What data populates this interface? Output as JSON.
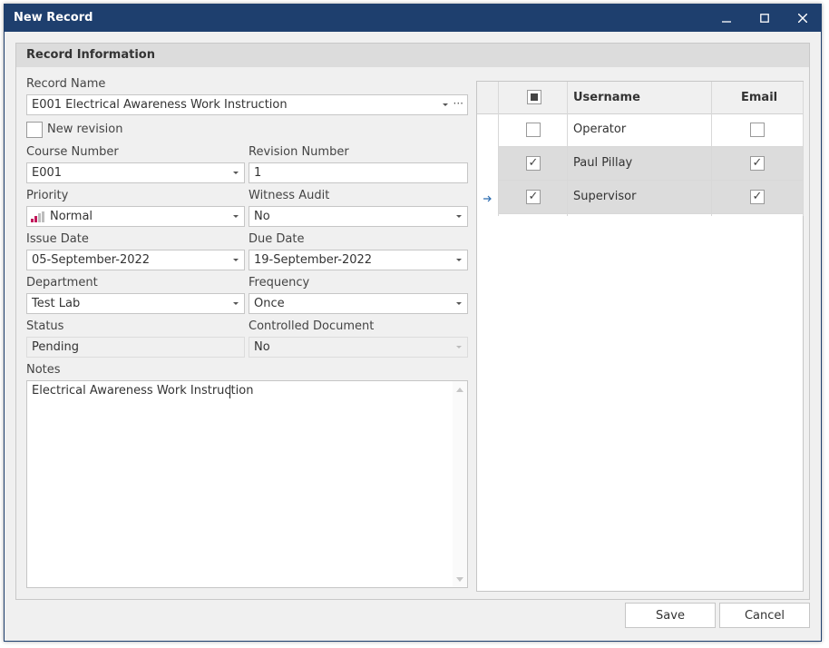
{
  "window": {
    "title": "New Record"
  },
  "group": {
    "title": "Record Information"
  },
  "record_name": {
    "label": "Record Name",
    "value": "E001 Electrical Awareness Work Instruction"
  },
  "new_revision": {
    "label": "New revision",
    "checked": false
  },
  "course_number": {
    "label": "Course Number",
    "value": "E001"
  },
  "revision_number": {
    "label": "Revision Number",
    "value": "1"
  },
  "priority": {
    "label": "Priority",
    "value": "Normal"
  },
  "witness_audit": {
    "label": "Witness Audit",
    "value": "No"
  },
  "issue_date": {
    "label": "Issue Date",
    "value": "05-September-2022"
  },
  "due_date": {
    "label": "Due Date",
    "value": "19-September-2022"
  },
  "department": {
    "label": "Department",
    "value": "Test Lab"
  },
  "frequency": {
    "label": "Frequency",
    "value": "Once"
  },
  "status": {
    "label": "Status",
    "value": "Pending"
  },
  "controlled_document": {
    "label": "Controlled Document",
    "value": "No"
  },
  "notes": {
    "label": "Notes",
    "value": "Electrical Awareness Work Instruction"
  },
  "users_grid": {
    "columns": [
      "Username",
      "Email"
    ],
    "rows": [
      {
        "username": "Operator",
        "selected": false,
        "email": false
      },
      {
        "username": "Paul Pillay",
        "selected": true,
        "email": true
      },
      {
        "username": "Supervisor",
        "selected": true,
        "email": true
      }
    ]
  },
  "footer": {
    "save_label": "Save",
    "cancel_label": "Cancel"
  },
  "colors": {
    "titlebar": "#1e3f6e",
    "accent": "#2b6cb0",
    "priority_icon": "#c2185b"
  }
}
